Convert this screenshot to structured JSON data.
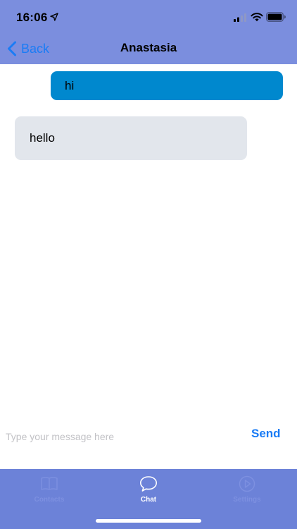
{
  "status_bar": {
    "time": "16:06",
    "icons": [
      "location-arrow-icon",
      "signal-icon",
      "wifi-icon",
      "battery-icon"
    ]
  },
  "nav": {
    "back_label": "Back",
    "title": "Anastasia"
  },
  "messages": [
    {
      "text": "hi",
      "direction": "outgoing"
    },
    {
      "text": "hello",
      "direction": "incoming"
    }
  ],
  "composer": {
    "placeholder": "Type your message here",
    "send_label": "Send"
  },
  "tabs": [
    {
      "label": "Contacts",
      "icon": "book-icon",
      "active": false
    },
    {
      "label": "Chat",
      "icon": "chat-bubble-icon",
      "active": true
    },
    {
      "label": "Settings",
      "icon": "play-circle-icon",
      "active": false
    }
  ],
  "colors": {
    "header_bg": "#7b8ede",
    "tab_bar_bg": "#6c82d8",
    "outgoing_bubble": "#0088ce",
    "incoming_bubble": "#e2e6ec",
    "accent": "#1a7cf5",
    "tab_inactive": "#7d90e0",
    "tab_active": "#ffffff"
  }
}
